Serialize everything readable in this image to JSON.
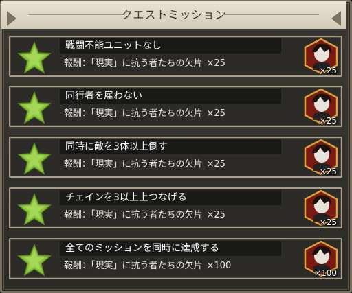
{
  "panel": {
    "title": "クエストミッション"
  },
  "missions": [
    {
      "name": "戦闘不能ユニットなし",
      "reward_label": "報酬：「現実」に抗う者たちの欠片",
      "reward_count": "×25",
      "item_qty": "×25"
    },
    {
      "name": "同行者を雇わない",
      "reward_label": "報酬：「現実」に抗う者たちの欠片",
      "reward_count": "×25",
      "item_qty": "×25"
    },
    {
      "name": "同時に敵を3体以上倒す",
      "reward_label": "報酬：「現実」に抗う者たちの欠片",
      "reward_count": "×25",
      "item_qty": "×25"
    },
    {
      "name": "チェインを3以上上つなげる",
      "reward_label": "報酬：「現実」に抗う者たちの欠片",
      "reward_count": "×25",
      "item_qty": "×25"
    },
    {
      "name": "全てのミッションを同時に達成する",
      "reward_label": "報酬：「現実」に抗う者たちの欠片",
      "reward_count": "×100",
      "item_qty": "×100"
    }
  ],
  "icons": {
    "status": "green-star-icon",
    "reward": "character-shard-icon"
  },
  "colors": {
    "star": "#8bc63a",
    "item_border": "#d9a23a",
    "item_bg": "#7a1a12"
  }
}
